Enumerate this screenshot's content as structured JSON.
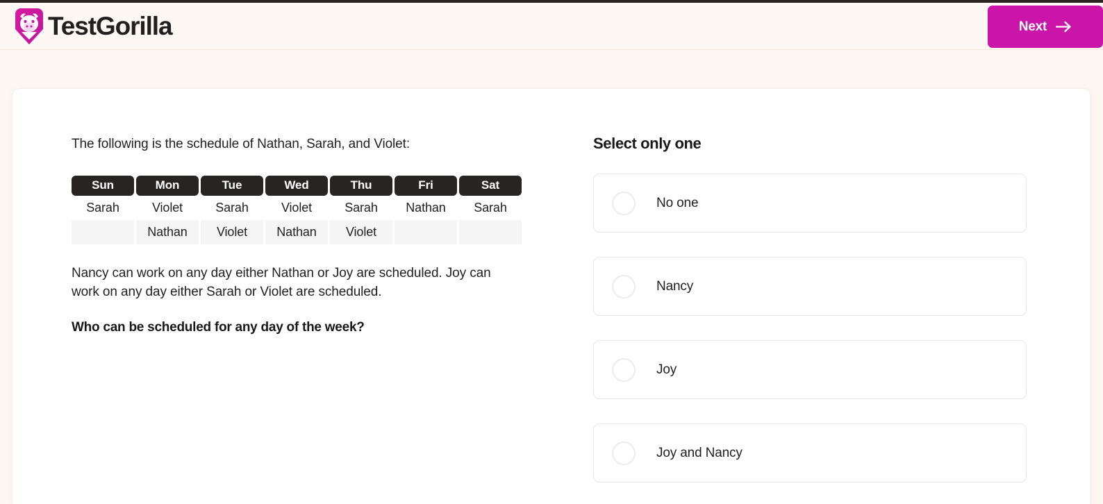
{
  "brand": {
    "name": "TestGorilla",
    "logo_icon": "gorilla-logo-icon",
    "accent_color": "#ca15a8",
    "logo_text_color": "#22201f"
  },
  "header": {
    "next_label": "Next",
    "next_icon": "arrow-right-icon"
  },
  "question": {
    "intro": "The following is the schedule of Nathan, Sarah, and Violet:",
    "body": "Nancy can work on any day either Nathan or Joy are scheduled. Joy can work on any day either Sarah or Violet are scheduled.",
    "prompt": "Who can be scheduled for any day of the week?"
  },
  "schedule_table": {
    "headers": [
      "Sun",
      "Mon",
      "Tue",
      "Wed",
      "Thu",
      "Fri",
      "Sat"
    ],
    "rows": [
      [
        "Sarah",
        "Violet",
        "Sarah",
        "Violet",
        "Sarah",
        "Nathan",
        "Sarah"
      ],
      [
        "",
        "Nathan",
        "Violet",
        "Nathan",
        "Violet",
        "",
        ""
      ]
    ]
  },
  "answers": {
    "title": "Select only one",
    "options": [
      {
        "label": "No one",
        "selected": false
      },
      {
        "label": "Nancy",
        "selected": false
      },
      {
        "label": "Joy",
        "selected": false
      },
      {
        "label": "Joy and Nancy",
        "selected": false
      }
    ]
  }
}
